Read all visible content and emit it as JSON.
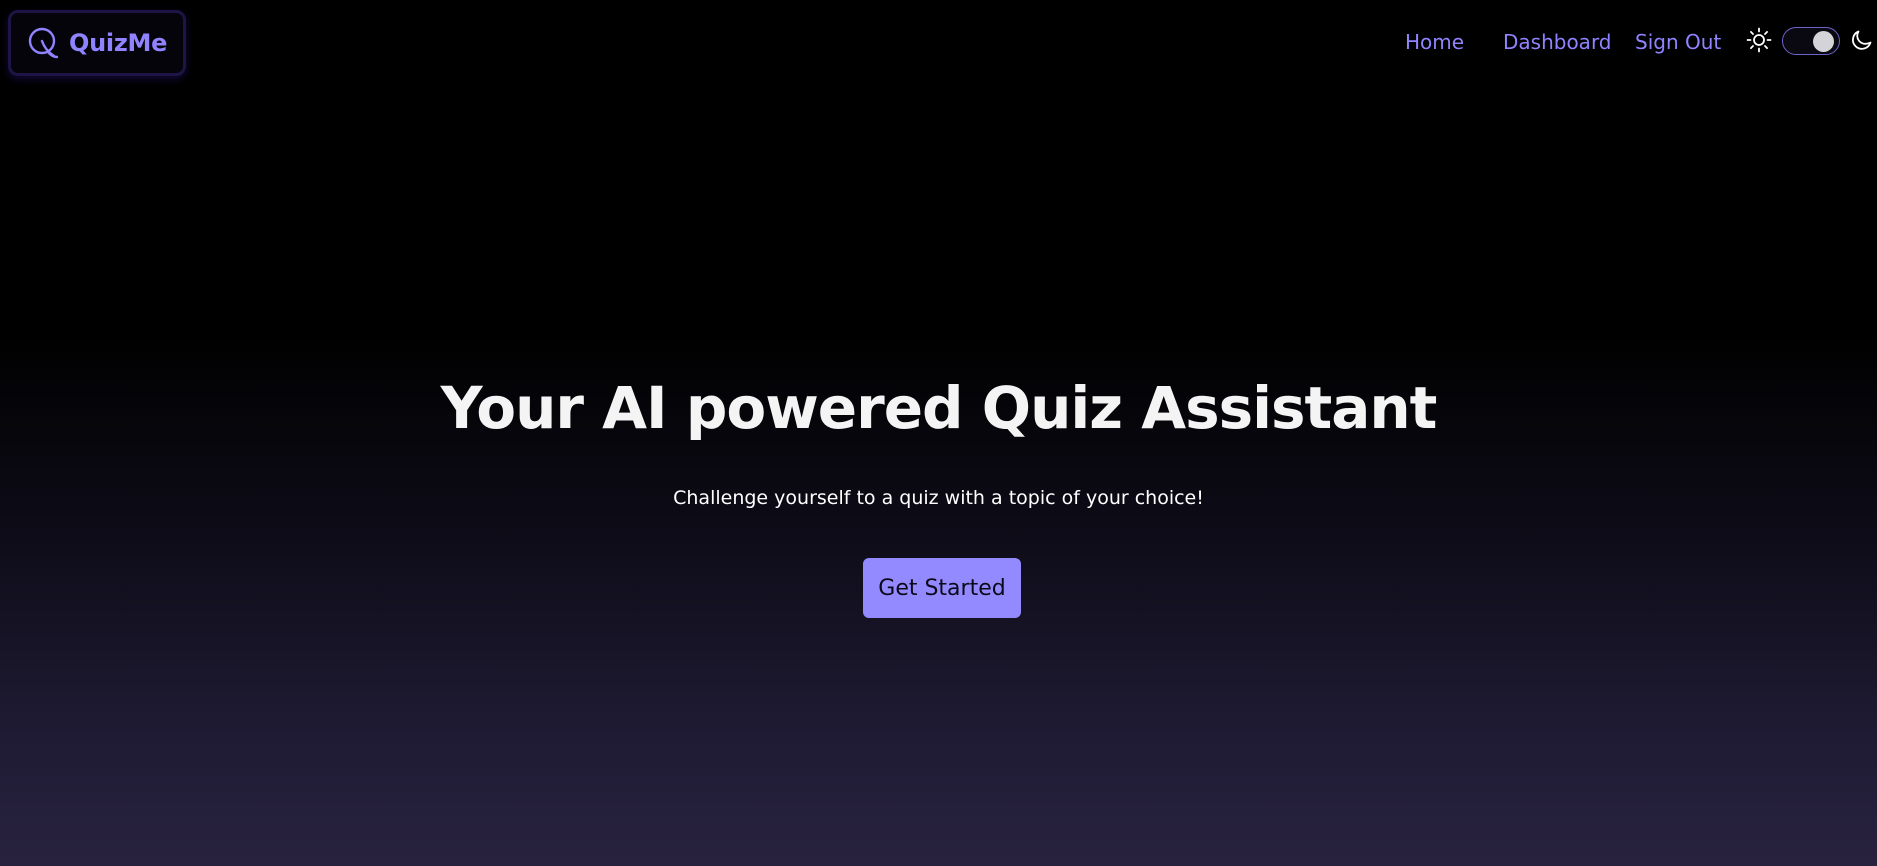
{
  "brand": {
    "name": "QuizMe",
    "icon": "q-logo-icon",
    "color": "#8f83ff"
  },
  "nav": {
    "links": [
      {
        "label": "Home"
      },
      {
        "label": "Dashboard"
      },
      {
        "label": "Sign Out"
      }
    ],
    "theme_toggle": {
      "light_icon": "sun-icon",
      "dark_icon": "moon-icon",
      "state": "dark"
    }
  },
  "hero": {
    "title": "Your AI powered Quiz Assistant",
    "subtitle": "Challenge yourself to a quiz with a topic of your choice!",
    "cta_label": "Get Started",
    "cta_color": "#948aff"
  }
}
